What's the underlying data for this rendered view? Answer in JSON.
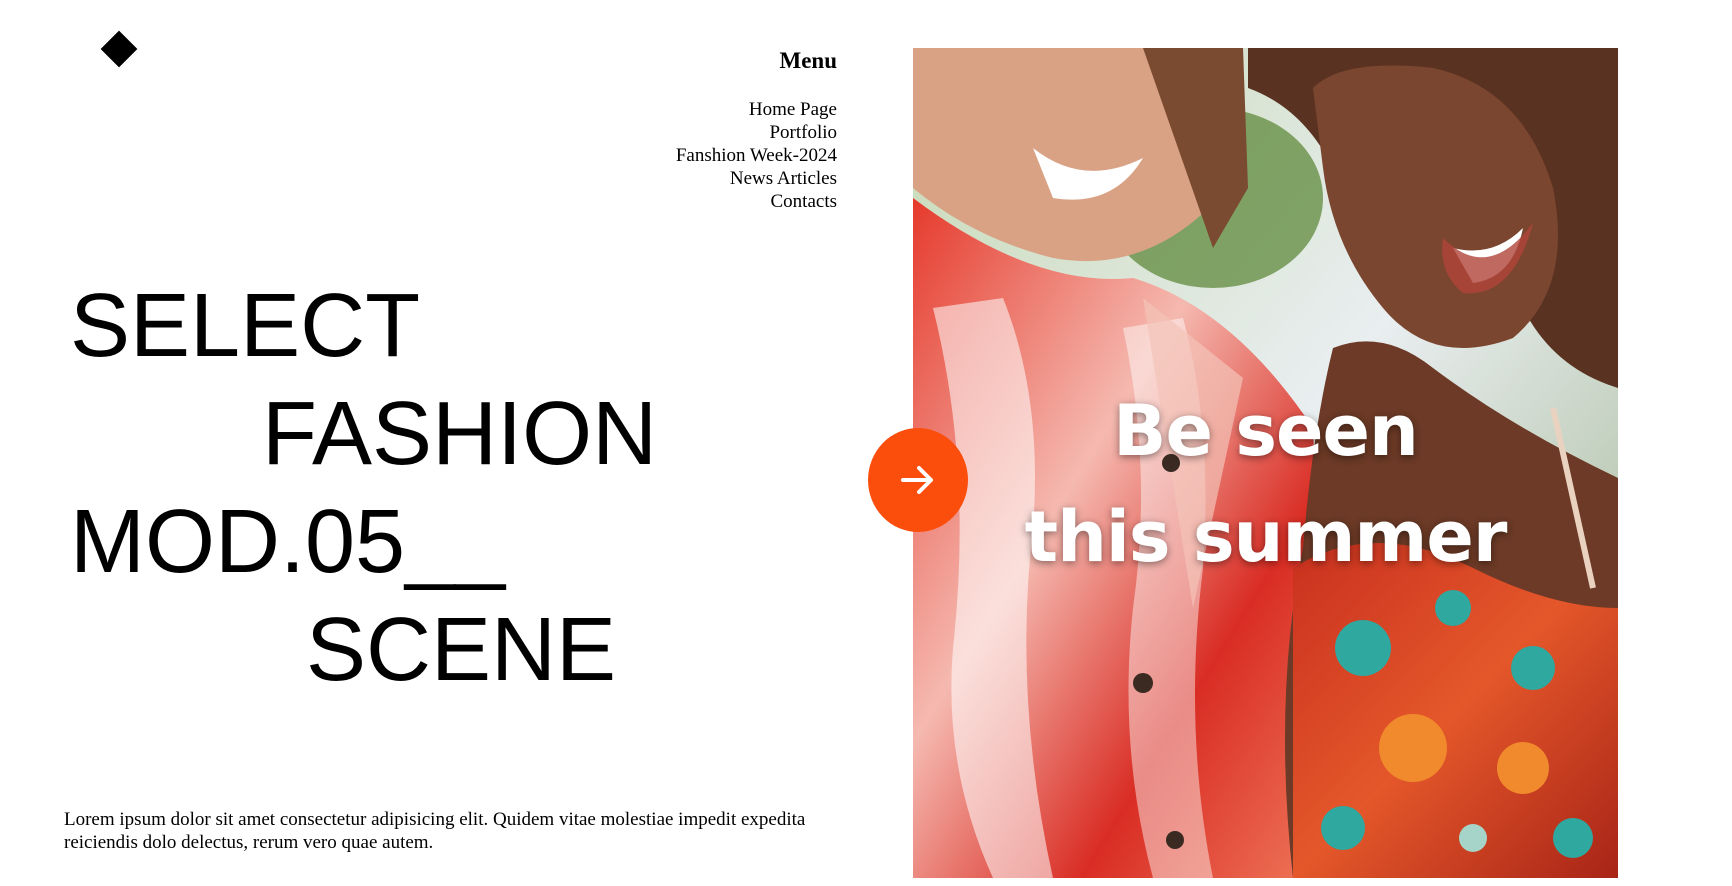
{
  "menu": {
    "title": "Menu",
    "items": [
      "Home Page",
      "Portfolio",
      "Fanshion Week-2024",
      "News Articles",
      "Contacts"
    ]
  },
  "headline": {
    "line1": "SELECT",
    "line2": "FASHION",
    "line3": "MOD.05__",
    "line4": "SCENE"
  },
  "intro": "Lorem ipsum dolor sit amet consectetur adipisicing elit. Quidem vitae molestiae impedit expedita reiciendis dolo delectus, rerum vero quae autem.",
  "hero": {
    "caption_line1": "Be seen",
    "caption_line2": "this summer",
    "next_icon": "arrow-right-icon"
  },
  "colors": {
    "accent": "#fb4d0c",
    "text": "#000000",
    "background": "#ffffff"
  }
}
